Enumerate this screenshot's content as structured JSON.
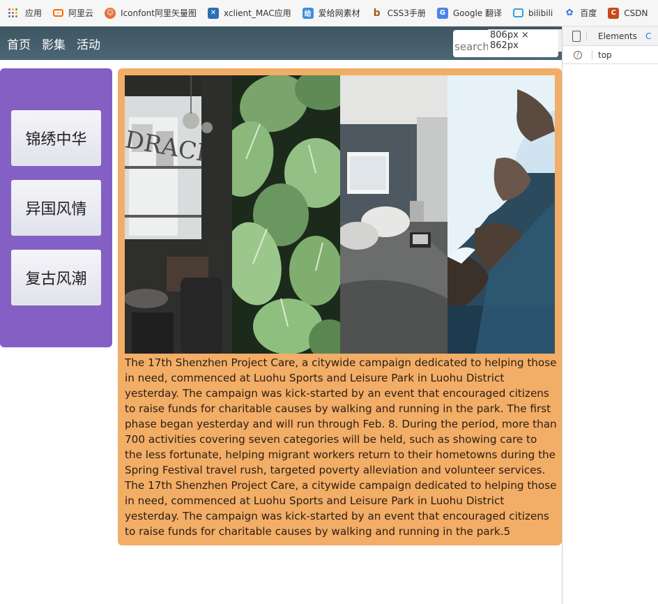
{
  "bookmarks": [
    {
      "label": "应用",
      "icon": "apps-grid-icon",
      "color": "#e0553c"
    },
    {
      "label": "阿里云",
      "icon": "aliyun-icon",
      "color": "#ff6a00"
    },
    {
      "label": "Iconfont阿里矢量图",
      "icon": "iconfont-icon",
      "color": "#e1723a"
    },
    {
      "label": "xclient_MAC应用",
      "icon": "xclient-icon",
      "color": "#2c6fb4"
    },
    {
      "label": "爱给网素材",
      "icon": "aigei-icon",
      "color": "#3e8edb"
    },
    {
      "label": "CSS3手册",
      "icon": "css3-icon",
      "color": "#a45a1c"
    },
    {
      "label": "Google 翻译",
      "icon": "google-translate-icon",
      "color": "#4a86e8"
    },
    {
      "label": "bilibili",
      "icon": "bilibili-icon",
      "color": "#2ca5e0"
    },
    {
      "label": "百度",
      "icon": "baidu-icon",
      "color": "#3b6fd6"
    },
    {
      "label": "CSDN",
      "icon": "csdn-icon",
      "color": "#c8481e"
    }
  ],
  "navbar": {
    "items": [
      "首页",
      "影集",
      "活动"
    ],
    "search_placeholder": "search...",
    "size_tip": "806px × 862px"
  },
  "sidebar": {
    "buttons": [
      "锦绣中华",
      "异国风情",
      "复古风潮"
    ]
  },
  "content": {
    "text": "The 17th Shenzhen Project Care, a citywide campaign dedicated to helping those in need, commenced at Luohu Sports and Leisure Park in Luohu District yesterday. The campaign was kick-started by an event that encouraged citizens to raise funds for charitable causes by walking and running in the park. The first phase began yesterday and will run through Feb. 8. During the period, more than 700 activities covering seven categories will be held, such as showing care to the less fortunate, helping migrant workers return to their hometowns during the Spring Festival travel rush, targeted poverty alleviation and volunteer services. The 17th Shenzhen Project Care, a citywide campaign dedicated to helping those in need, commenced at Luohu Sports and Leisure Park in Luohu District yesterday. The campaign was kick-started by an event that encouraged citizens to raise funds for charitable causes by walking and running in the park.5"
  },
  "devtools": {
    "tabs": [
      "Elements",
      "C"
    ],
    "context": "top"
  },
  "colors": {
    "navbar": "#465d6b",
    "sidebar": "#8460c5",
    "content": "#f2ad67"
  }
}
